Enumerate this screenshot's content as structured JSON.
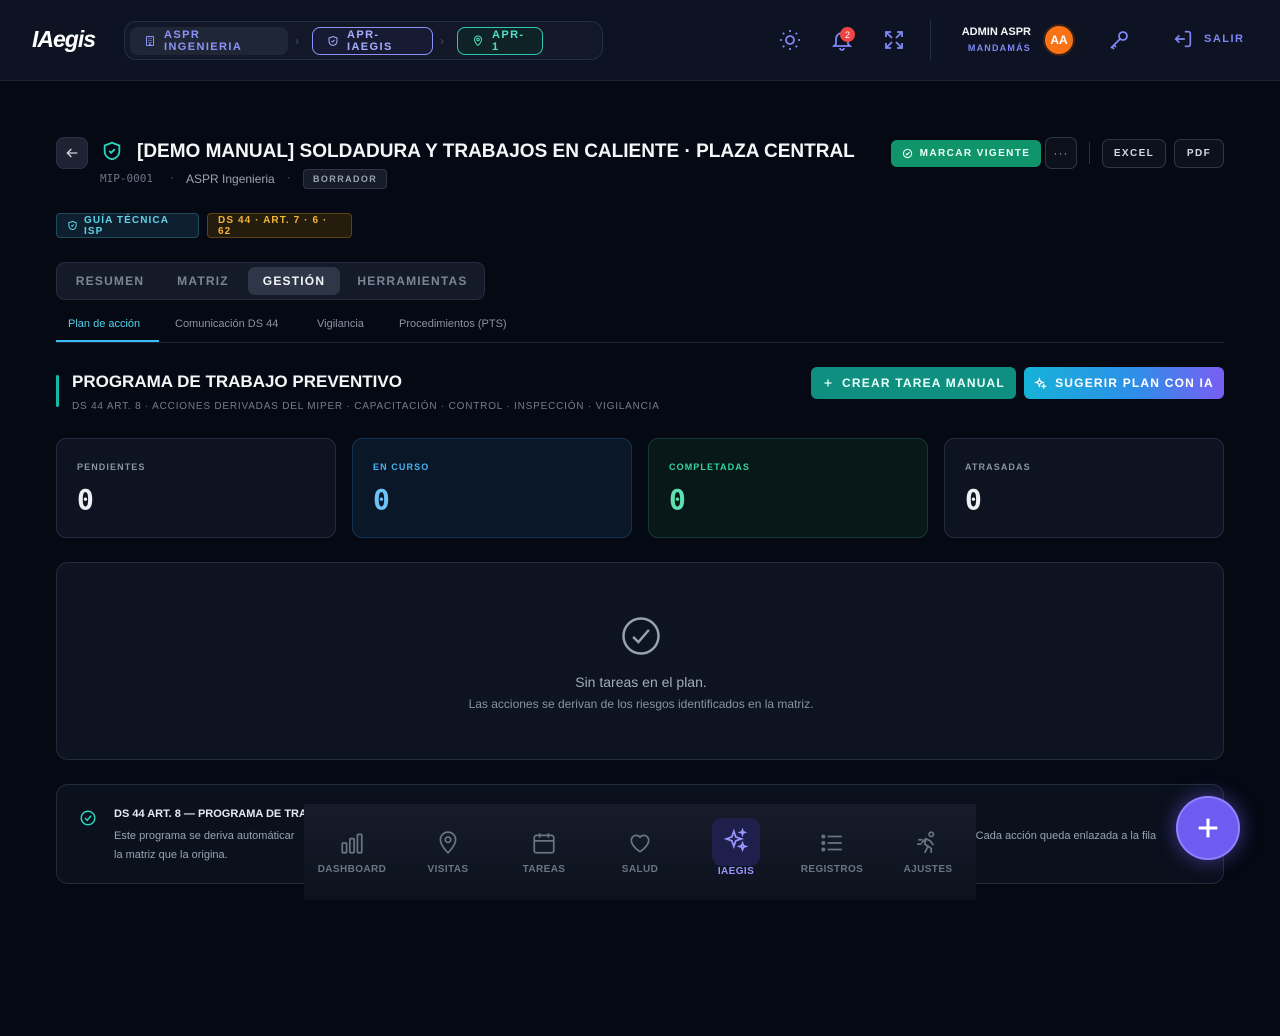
{
  "app": {
    "logo": "IAegis"
  },
  "breadcrumbs": [
    {
      "label": "ASPR INGENIERIA",
      "icon": "building-icon"
    },
    {
      "label": "APR-IAEGIS",
      "icon": "shield-icon"
    },
    {
      "label": "APR-1",
      "icon": "map-pin-icon"
    }
  ],
  "topbar": {
    "notifications_count": "2",
    "user_name": "ADMIN ASPR",
    "user_role": "MANDAMÁS",
    "avatar_initials": "AA",
    "logout_label": "SALIR"
  },
  "header": {
    "title": "[DEMO MANUAL] SOLDADURA Y TRABAJOS EN CALIENTE · PLAZA CENTRAL",
    "code": "MIP-0001",
    "company": "ASPR Ingenieria",
    "status": "BORRADOR",
    "btn_vigente": "MARCAR VIGENTE",
    "btn_more": "···",
    "btn_excel": "EXCEL",
    "btn_pdf": "PDF"
  },
  "tags": [
    {
      "label": "GUÍA TÉCNICA ISP"
    },
    {
      "label": "DS 44 · ART. 7 · 6 · 62"
    }
  ],
  "tabs": [
    {
      "label": "RESUMEN"
    },
    {
      "label": "MATRIZ"
    },
    {
      "label": "GESTIÓN",
      "active": true
    },
    {
      "label": "HERRAMIENTAS"
    }
  ],
  "subtabs": [
    {
      "label": "Plan de acción",
      "active": true
    },
    {
      "label": "Comunicación DS 44"
    },
    {
      "label": "Vigilancia"
    },
    {
      "label": "Procedimientos (PTS)"
    }
  ],
  "section": {
    "title": "PROGRAMA DE TRABAJO PREVENTIVO",
    "subtitle": "DS 44 ART. 8 · ACCIONES DERIVADAS DEL MIPER · CAPACITACIÓN · CONTROL · INSPECCIÓN · VIGILANCIA",
    "btn_crear": "CREAR TAREA MANUAL",
    "btn_ia": "SUGERIR PLAN CON IA"
  },
  "stats": [
    {
      "label": "PENDIENTES",
      "value": "0"
    },
    {
      "label": "EN CURSO",
      "value": "0"
    },
    {
      "label": "COMPLETADAS",
      "value": "0"
    },
    {
      "label": "ATRASADAS",
      "value": "0"
    }
  ],
  "empty_state": {
    "title": "Sin tareas en el plan.",
    "subtitle": "Las acciones se derivan de los riesgos identificados en la matriz."
  },
  "info": {
    "title": "DS 44 ART. 8 — PROGRAMA DE TRA",
    "line1_start": "Este programa se deriva automáticar",
    "line1_end": "ia. Cada acción queda enlazada a la fila",
    "line2": "la matriz que la origina."
  },
  "bottom_nav": [
    {
      "label": "DASHBOARD",
      "icon": "bar-chart-icon"
    },
    {
      "label": "VISITAS",
      "icon": "map-pin-icon"
    },
    {
      "label": "TAREAS",
      "icon": "calendar-icon"
    },
    {
      "label": "SALUD",
      "icon": "heart-icon"
    },
    {
      "label": "IAEGIS",
      "icon": "sparkles-icon",
      "active": true
    },
    {
      "label": "REGISTROS",
      "icon": "list-icon"
    },
    {
      "label": "AJUSTES",
      "icon": "running-person-icon"
    }
  ],
  "colors": {
    "accent": "#7f86f5",
    "teal": "#14b8a6",
    "success": "#10946a",
    "warning": "#f2b43b",
    "fab": "#6d5cf0"
  }
}
